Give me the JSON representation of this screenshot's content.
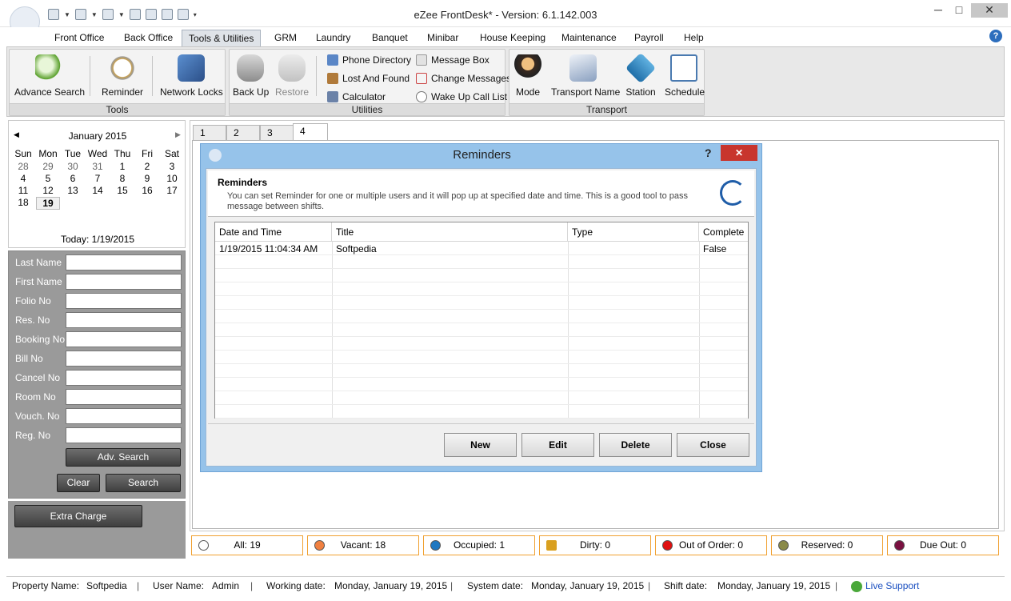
{
  "app": {
    "title": "eZee FrontDesk* - Version: 6.1.142.003",
    "minimize_label": "─",
    "maximize_label": "□",
    "close_label": "✕"
  },
  "menu": {
    "items": [
      {
        "label": "Front Office"
      },
      {
        "label": "Back Office"
      },
      {
        "label": "Tools & Utilities"
      },
      {
        "label": "GRM"
      },
      {
        "label": "Laundry"
      },
      {
        "label": "Banquet"
      },
      {
        "label": "Minibar"
      },
      {
        "label": "House Keeping"
      },
      {
        "label": "Maintenance"
      },
      {
        "label": "Payroll"
      },
      {
        "label": "Help"
      }
    ],
    "active": "Tools & Utilities",
    "help_icon_label": "?"
  },
  "ribbon": {
    "tools": {
      "label": "Tools",
      "buttons": [
        {
          "label": "Advance Search",
          "icon": "magnifier-icon"
        },
        {
          "label": "Reminder",
          "icon": "alarm-clock-icon"
        },
        {
          "label": "Network Locks",
          "icon": "network-icon"
        }
      ]
    },
    "utilities": {
      "label": "Utilities",
      "buttons": [
        {
          "label": "Back Up",
          "icon": "database-icon"
        },
        {
          "label": "Restore",
          "icon": "database-restore-icon"
        }
      ],
      "small_buttons": [
        {
          "label": "Phone Directory",
          "icon": "phone-icon"
        },
        {
          "label": "Lost And Found",
          "icon": "box-icon"
        },
        {
          "label": "Calculator",
          "icon": "calculator-icon"
        },
        {
          "label": "Message Box",
          "icon": "message-icon"
        },
        {
          "label": "Change Messages",
          "icon": "edit-message-icon"
        },
        {
          "label": "Wake Up Call List",
          "icon": "clock-icon"
        }
      ]
    },
    "transport": {
      "label": "Transport",
      "buttons": [
        {
          "label": "Mode",
          "icon": "driver-icon"
        },
        {
          "label": "Transport Name",
          "icon": "airplane-icon"
        },
        {
          "label": "Station",
          "icon": "station-icon"
        },
        {
          "label": "Schedule",
          "icon": "notepad-icon"
        }
      ]
    }
  },
  "calendar": {
    "month_label": "January 2015",
    "prev": "◀",
    "next": "▶",
    "weekdays": [
      "Sun",
      "Mon",
      "Tue",
      "Wed",
      "Thu",
      "Fri",
      "Sat"
    ],
    "weeks": [
      [
        "28",
        "29",
        "30",
        "31",
        "1",
        "2",
        "3"
      ],
      [
        "4",
        "5",
        "6",
        "7",
        "8",
        "9",
        "10"
      ],
      [
        "11",
        "12",
        "13",
        "14",
        "15",
        "16",
        "17"
      ],
      [
        "18",
        "19",
        "",
        "",
        "",
        "",
        ""
      ]
    ],
    "selected": "19",
    "today_label": "Today: 1/19/2015"
  },
  "search": {
    "fields": [
      {
        "label": "Last Name",
        "value": ""
      },
      {
        "label": "First Name",
        "value": ""
      },
      {
        "label": "Folio No",
        "value": ""
      },
      {
        "label": "Res. No",
        "value": ""
      },
      {
        "label": "Booking No",
        "value": ""
      },
      {
        "label": "Bill No",
        "value": ""
      },
      {
        "label": "Cancel No",
        "value": ""
      },
      {
        "label": "Room No",
        "value": ""
      },
      {
        "label": "Vouch. No",
        "value": ""
      },
      {
        "label": "Reg. No",
        "value": ""
      }
    ],
    "adv_search_label": "Adv. Search",
    "clear_label": "Clear",
    "search_label": "Search",
    "extra_charge_label": "Extra Charge"
  },
  "tabs": [
    "1",
    "2",
    "3",
    "4"
  ],
  "active_tab": "4",
  "dialog": {
    "title": "Reminders",
    "help_label": "?",
    "close_label": "✕",
    "header_title": "Reminders",
    "header_desc": "You can set Reminder for one or multiple users and it will pop up at specified date and time. This is a good tool to pass message between shifts.",
    "columns": [
      "Date and Time",
      "Title",
      "Type",
      "Complete"
    ],
    "rows": [
      {
        "date": "1/19/2015 11:04:34 AM",
        "title": "Softpedia",
        "type": "",
        "complete": "False"
      }
    ],
    "buttons": {
      "new": "New",
      "edit": "Edit",
      "delete": "Delete",
      "close": "Close"
    }
  },
  "status": {
    "items": [
      {
        "label": "All: 19",
        "color": "#ffffff"
      },
      {
        "label": "Vacant: 18",
        "color": "#f08040"
      },
      {
        "label": "Occupied: 1",
        "color": "#1f78c1"
      },
      {
        "label": "Dirty: 0",
        "color": "#d9a020",
        "icon": "broom-icon"
      },
      {
        "label": "Out of Order: 0",
        "color": "#e01010"
      },
      {
        "label": "Reserved: 0",
        "color": "#8a8a4a"
      },
      {
        "label": "Due Out: 0",
        "color": "#7a1040"
      }
    ]
  },
  "footer": {
    "property_label": "Property Name:",
    "property_value": "Softpedia",
    "user_label": "User Name:",
    "user_value": "Admin",
    "working_label": "Working date:",
    "working_value": "Monday, January 19, 2015",
    "system_label": "System date:",
    "system_value": "Monday, January 19, 2015",
    "shift_label": "Shift date:",
    "shift_value": "Monday, January 19, 2015",
    "live_support_label": "Live Support",
    "separator": "|"
  }
}
